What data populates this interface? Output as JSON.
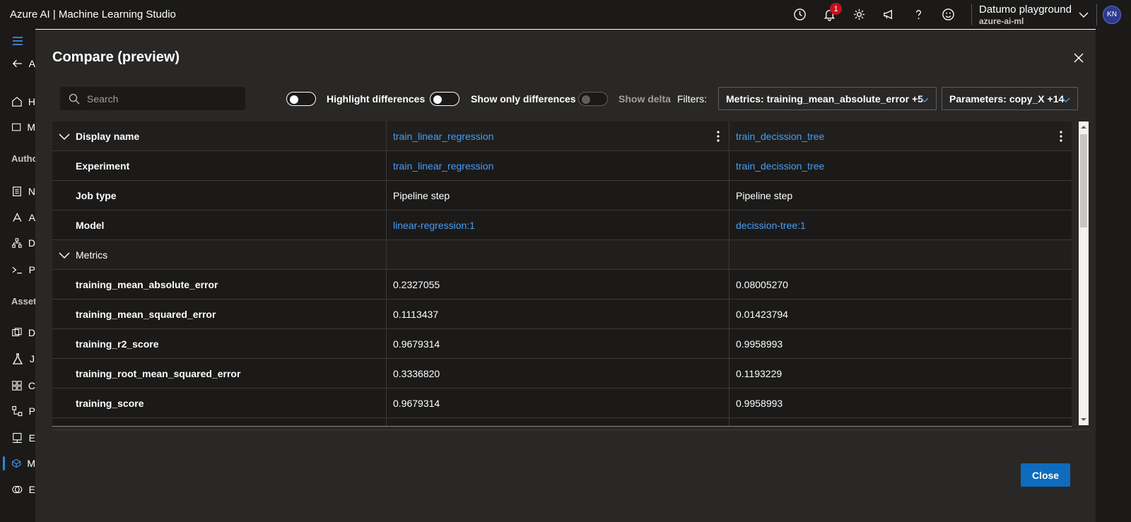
{
  "app": {
    "title": "Azure AI | Machine Learning Studio",
    "notification_count": "1",
    "workspace_name": "Datumo playground",
    "workspace_sub": "azure-ai-ml",
    "avatar_initials": "KN"
  },
  "leftnav": {
    "items": [
      {
        "label": "A",
        "icon": "back-arrow-icon"
      },
      {
        "label": "H",
        "icon": "home-icon"
      },
      {
        "label": "M",
        "icon": "model-catalog-icon"
      },
      {
        "label": "N",
        "icon": "notebook-icon"
      },
      {
        "label": "A",
        "icon": "automl-icon"
      },
      {
        "label": "D",
        "icon": "designer-icon"
      },
      {
        "label": "P",
        "icon": "prompt-icon"
      },
      {
        "label": "D",
        "icon": "data-icon"
      },
      {
        "label": "J",
        "icon": "jobs-icon"
      },
      {
        "label": "C",
        "icon": "components-icon"
      },
      {
        "label": "P",
        "icon": "pipelines-icon"
      },
      {
        "label": "E",
        "icon": "environments-icon"
      },
      {
        "label": "M",
        "icon": "models-icon"
      },
      {
        "label": "E",
        "icon": "endpoints-icon"
      }
    ],
    "sections": [
      "Autho",
      "Asset"
    ]
  },
  "modal": {
    "title": "Compare (preview)",
    "search_placeholder": "Search",
    "toggles": [
      {
        "label": "Highlight differences",
        "on": true
      },
      {
        "label": "Show only differences",
        "on": true
      },
      {
        "label": "Show delta",
        "on": false
      }
    ],
    "filters_label": "Filters:",
    "metrics_filter": "Metrics: training_mean_absolute_error +5",
    "parameters_filter": "Parameters: copy_X +14",
    "close_label": "Close"
  },
  "table": {
    "header": {
      "label": "Display name",
      "col1": "train_linear_regression",
      "col2": "train_decission_tree"
    },
    "rows": [
      {
        "label": "Experiment",
        "col1": "train_linear_regression",
        "col2": "train_decission_tree",
        "link": true
      },
      {
        "label": "Job type",
        "col1": "Pipeline step",
        "col2": "Pipeline step",
        "link": false
      },
      {
        "label": "Model",
        "col1": "linear-regression:1",
        "col2": "decission-tree:1",
        "link": true
      }
    ],
    "metrics_section": "Metrics",
    "metrics": [
      {
        "label": "training_mean_absolute_error",
        "col1": "0.2327055",
        "col2": "0.08005270"
      },
      {
        "label": "training_mean_squared_error",
        "col1": "0.1113437",
        "col2": "0.01423794"
      },
      {
        "label": "training_r2_score",
        "col1": "0.9679314",
        "col2": "0.9958993"
      },
      {
        "label": "training_root_mean_squared_error",
        "col1": "0.3336820",
        "col2": "0.1193229"
      },
      {
        "label": "training_score",
        "col1": "0.9679314",
        "col2": "0.9958993"
      }
    ]
  }
}
